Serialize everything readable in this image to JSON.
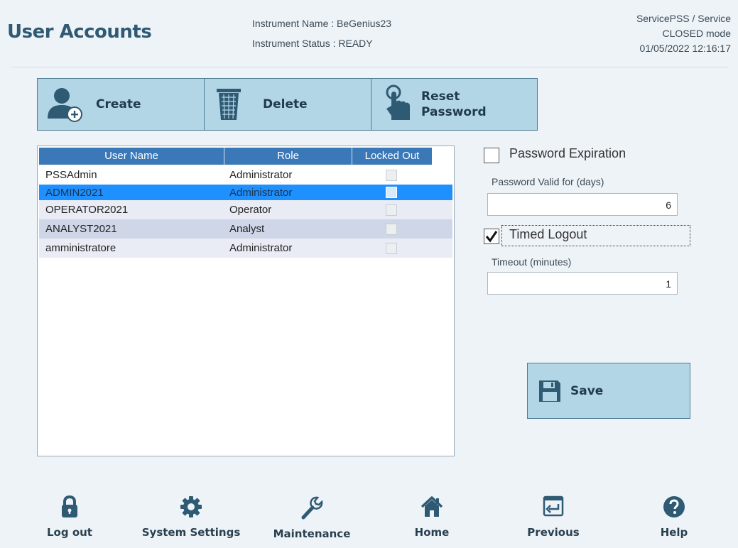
{
  "header": {
    "title": "User Accounts",
    "instrument_name": "Instrument Name : BeGenius23",
    "instrument_status": "Instrument Status : READY",
    "user": "ServicePSS / Service",
    "mode": "CLOSED mode",
    "datetime": "01/05/2022 12:16:17"
  },
  "toolbar": {
    "create_label": "Create",
    "delete_label": "Delete",
    "reset_label_1": "Reset",
    "reset_label_2": "Password"
  },
  "table": {
    "columns": [
      "User Name",
      "Role",
      "Locked Out"
    ],
    "rows": [
      {
        "name": "PSSAdmin",
        "role": "Administrator",
        "locked": false
      },
      {
        "name": "ADMIN2021",
        "role": "Administrator",
        "locked": false,
        "selected": true
      },
      {
        "name": "OPERATOR2021",
        "role": "Operator",
        "locked": false
      },
      {
        "name": "ANALYST2021",
        "role": "Analyst",
        "locked": false
      },
      {
        "name": "amministratore",
        "role": "Administrator",
        "locked": false
      }
    ]
  },
  "options": {
    "password_expiration_label": "Password Expiration",
    "password_expiration_checked": false,
    "password_valid_label": "Password Valid for (days)",
    "password_valid_value": "6",
    "timed_logout_label": "Timed Logout",
    "timed_logout_checked": true,
    "timeout_label": "Timeout (minutes)",
    "timeout_value": "1"
  },
  "save_label": "Save",
  "nav": {
    "logout": "Log out",
    "system_settings": "System Settings",
    "maintenance": "Maintenance",
    "home": "Home",
    "previous": "Previous",
    "help": "Help"
  },
  "colors": {
    "accent": "#3a78b8",
    "button": "#b3d6e6",
    "header_title": "#2f5a73",
    "icon": "#2f5a73",
    "selected_row": "#1e90ff",
    "alt_row": "#cfd6e8"
  }
}
